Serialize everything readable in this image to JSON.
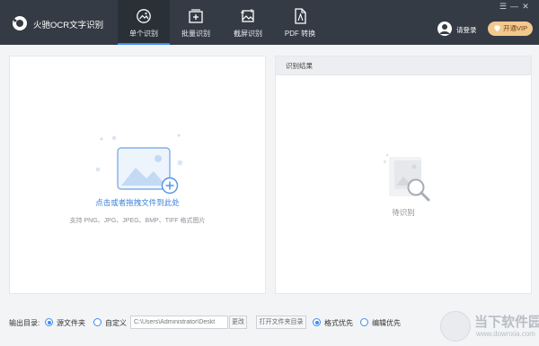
{
  "app": {
    "title": "火驰OCR文字识别"
  },
  "tabs": [
    {
      "label": "单个识别",
      "icon": "single-recognize-icon",
      "active": true
    },
    {
      "label": "批量识别",
      "icon": "batch-recognize-icon",
      "active": false
    },
    {
      "label": "截屏识别",
      "icon": "screenshot-recognize-icon",
      "active": false
    },
    {
      "label": "PDF 转换",
      "icon": "pdf-convert-icon",
      "active": false
    }
  ],
  "header": {
    "login_label": "请登录",
    "vip_label": "开通VIP",
    "window_controls": [
      "☰",
      "—",
      "✕"
    ]
  },
  "drop_area": {
    "hint": "点击或者拖拽文件到此处",
    "formats": "支持 PNG、JPG、JPEG、BMP、TIFF 格式图片"
  },
  "result": {
    "header": "识别结果",
    "empty_text": "待识别"
  },
  "output": {
    "label": "输出目录:",
    "option_source": "源文件夹",
    "option_custom": "自定义",
    "path_value": "C:\\Users\\Administrator\\Deskt",
    "change_button": "更改",
    "open_folder_button": "打开文件夹目录",
    "format_priority": "格式优先",
    "edit_priority": "编辑优先",
    "selected_dir_option": "源文件夹",
    "selected_priority": "格式优先"
  },
  "watermark": {
    "title": "当下软件园",
    "subtitle": "www.downxia.com"
  },
  "colors": {
    "header_bg": "#343b45",
    "accent": "#3c8df0",
    "vip_bg": "#f3c88e"
  }
}
